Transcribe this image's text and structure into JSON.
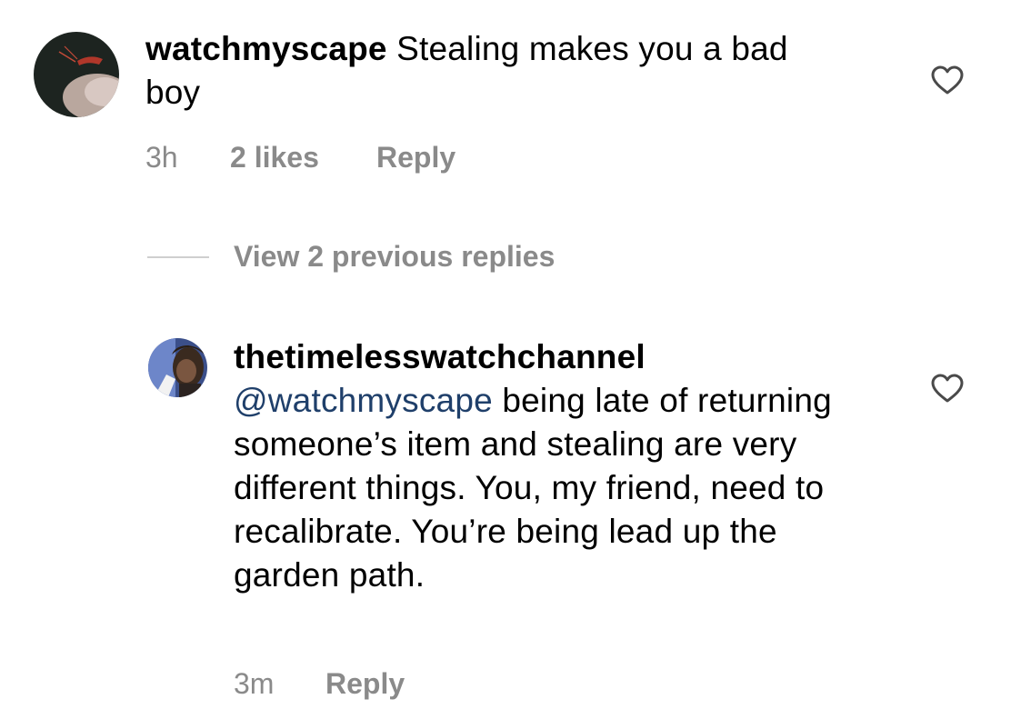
{
  "comments": [
    {
      "username": "watchmyscape",
      "text": "Stealing makes you a bad boy",
      "time": "3h",
      "likes": "2 likes",
      "reply_label": "Reply",
      "like_icon": "heart-outline-icon"
    },
    {
      "username": "thetimelesswatchchannel",
      "mention": "@watchmyscape",
      "text": "being late of returning someone’s item and stealing are very different things. You, my friend, need to recalibrate. You’re being lead up the garden path.",
      "time": "3m",
      "reply_label": "Reply",
      "like_icon": "heart-outline-icon"
    }
  ],
  "view_replies": {
    "label": "View 2 previous replies"
  },
  "colors": {
    "text": "#000000",
    "meta": "#8a8a8a",
    "mention": "#1f3f6a",
    "divider": "#cfcfcf"
  }
}
